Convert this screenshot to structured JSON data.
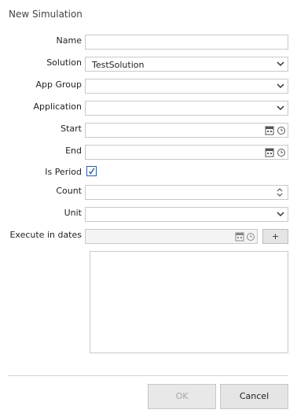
{
  "window": {
    "title": "New Simulation"
  },
  "form": {
    "name": {
      "label": "Name",
      "value": ""
    },
    "solution": {
      "label": "Solution",
      "value": "TestSolution"
    },
    "app_group": {
      "label": "App Group",
      "value": ""
    },
    "application": {
      "label": "Application",
      "value": ""
    },
    "start": {
      "label": "Start",
      "value": ""
    },
    "end": {
      "label": "End",
      "value": ""
    },
    "is_period": {
      "label": "Is Period",
      "checked": true,
      "mark": "✓"
    },
    "count": {
      "label": "Count",
      "value": ""
    },
    "unit": {
      "label": "Unit",
      "value": ""
    },
    "execute_in_dates": {
      "label": "Execute in dates",
      "value": "",
      "add_label": "+"
    }
  },
  "buttons": {
    "ok": "OK",
    "cancel": "Cancel"
  },
  "colors": {
    "checkbox_border": "#2f5a9e",
    "ok_disabled_text": "#a9a9a9"
  }
}
